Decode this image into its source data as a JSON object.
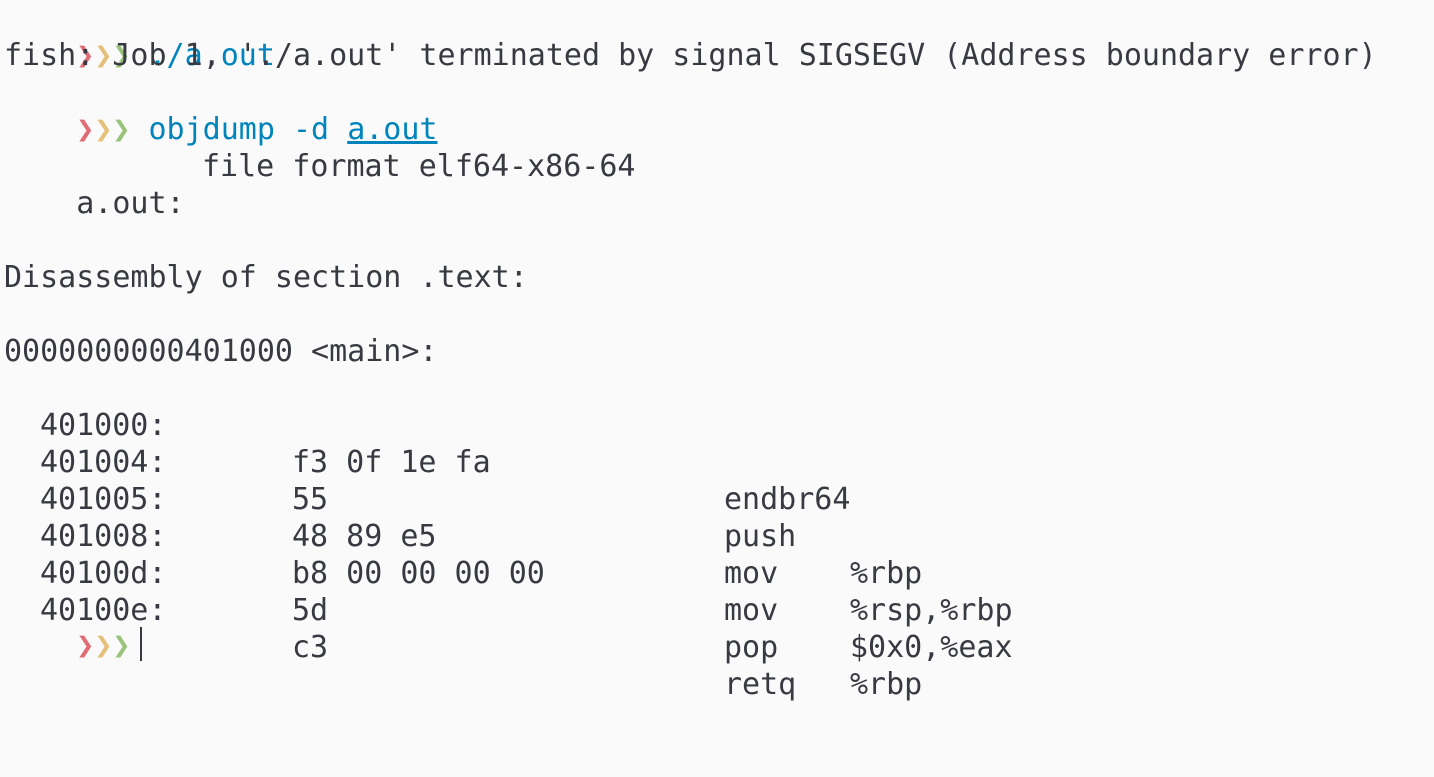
{
  "prompt": {
    "symbol_1": "❯",
    "symbol_2": "❯",
    "symbol_3": "❯"
  },
  "lines": {
    "cmd1": "./a.out",
    "error": "fish: Job 1, './a.out' terminated by signal SIGSEGV (Address boundary error)",
    "cmd2_name": "objdump -d",
    "cmd2_arg": "a.out",
    "file_format_label": "a.out:",
    "file_format_value": "file format elf64-x86-64",
    "section_header": "Disassembly of section .text:",
    "symbol": "0000000000401000 <main>:"
  },
  "disassembly": [
    {
      "addr": "401000:",
      "bytes": "f3 0f 1e fa",
      "mnemonic": "endbr64",
      "operands": ""
    },
    {
      "addr": "401004:",
      "bytes": "55",
      "mnemonic": "push",
      "operands": "%rbp"
    },
    {
      "addr": "401005:",
      "bytes": "48 89 e5",
      "mnemonic": "mov",
      "operands": "%rsp,%rbp"
    },
    {
      "addr": "401008:",
      "bytes": "b8 00 00 00 00",
      "mnemonic": "mov",
      "operands": "$0x0,%eax"
    },
    {
      "addr": "40100d:",
      "bytes": "5d",
      "mnemonic": "pop",
      "operands": "%rbp"
    },
    {
      "addr": "40100e:",
      "bytes": "c3",
      "mnemonic": "retq",
      "operands": ""
    }
  ],
  "colors": {
    "background": "#fafafa",
    "text": "#383a42",
    "command": "#0184bc",
    "prompt_red": "#e06c75",
    "prompt_yellow": "#e5c07b",
    "prompt_green": "#98c379"
  }
}
